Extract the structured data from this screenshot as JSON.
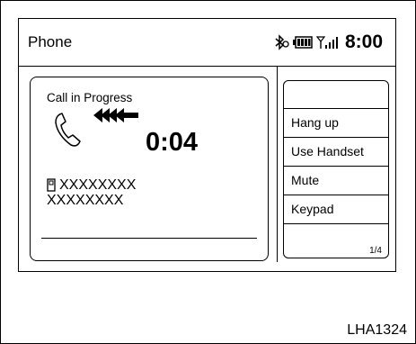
{
  "header": {
    "title": "Phone",
    "time": "8:00"
  },
  "status_icons": [
    "bluetooth-icon",
    "battery-icon",
    "signal-icon"
  ],
  "call": {
    "status": "Call in Progress",
    "timer": "0:04",
    "caller_line1": "XXXXXXXX",
    "caller_line2": "XXXXXXXX"
  },
  "menu": {
    "items": [
      "Hang up",
      "Use Handset",
      "Mute",
      "Keypad"
    ],
    "page_indicator": "1/4"
  },
  "figure_id": "LHA1324"
}
